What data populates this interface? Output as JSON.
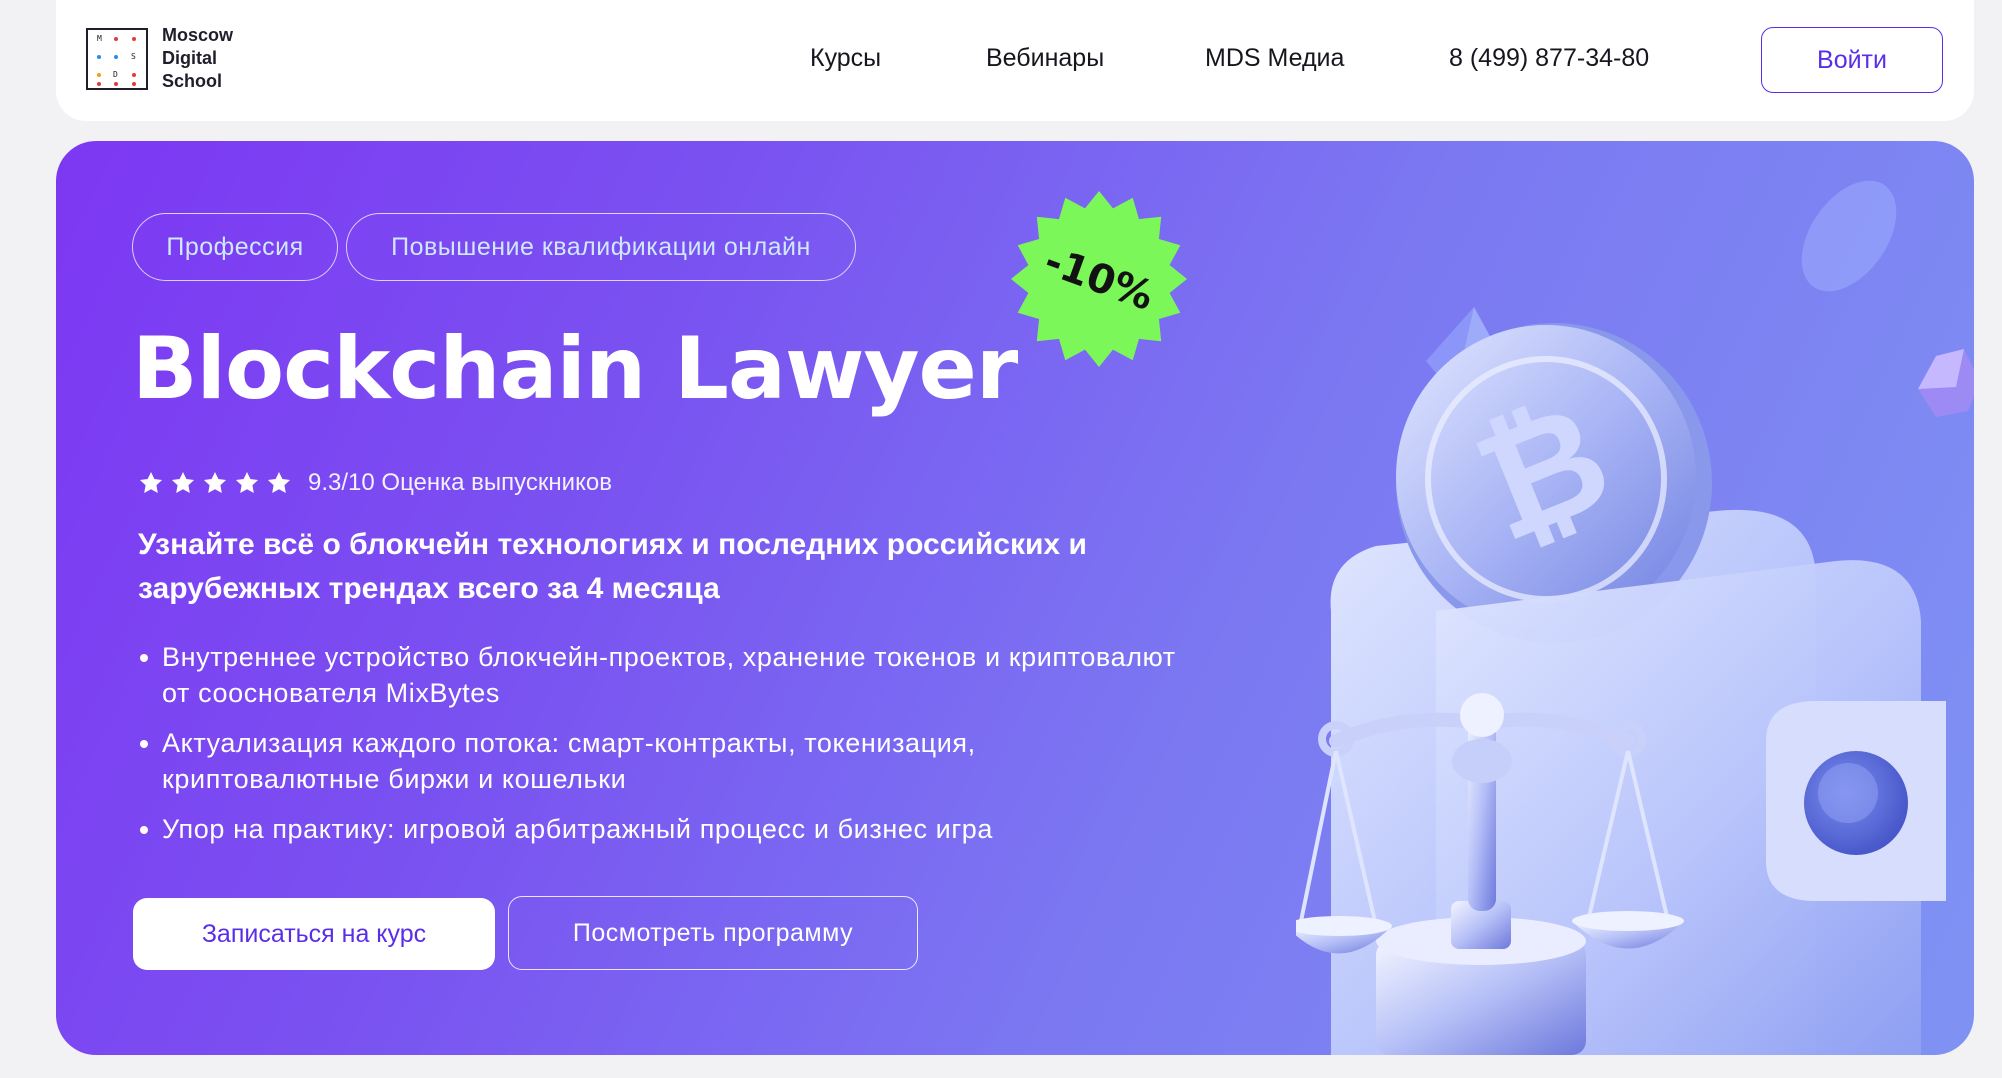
{
  "header": {
    "logo": {
      "lines": [
        "Moscow",
        "Digital",
        "School"
      ],
      "mark_letters": [
        "M",
        "S",
        "D"
      ]
    },
    "nav": [
      {
        "label": "Курсы"
      },
      {
        "label": "Вебинары"
      },
      {
        "label": "MDS Медиа"
      }
    ],
    "phone": "8 (499) 877-34-80",
    "login_label": "Войти"
  },
  "hero": {
    "tags": [
      "Профессия",
      "Повышение квалификации онлайн"
    ],
    "title": "Blockchain Lawyer",
    "discount_badge": "-10%",
    "rating": {
      "stars": 5,
      "text": "9.3/10 Оценка выпускников"
    },
    "subtitle": "Узнайте всё о блокчейн технологиях и последних российских и зарубежных трендах всего за 4 месяца",
    "features": [
      "Внутреннее устройство блокчейн-проектов, хранение токенов и криптовалют от сооснователя MixBytes",
      "Актуализация каждого потока: смарт-контракты, токенизация, криптовалютные биржи и кошельки",
      "Упор на практику: игровой арбитражный процесс и бизнес игра"
    ],
    "primary_button": "Записаться на курс",
    "secondary_button": "Посмотреть программу"
  },
  "icons": {
    "logo": "mds-logo-icon",
    "star": "star-icon",
    "badge": "starburst-badge-icon",
    "illustration": "bitcoin-wallet-scales-illustration"
  },
  "colors": {
    "brand": "#5a2ee8",
    "hero_gradient_start": "#7d37f2",
    "hero_gradient_end": "#7f93f3",
    "badge": "#7cf75a",
    "tag_text": "#cfe8ff"
  }
}
